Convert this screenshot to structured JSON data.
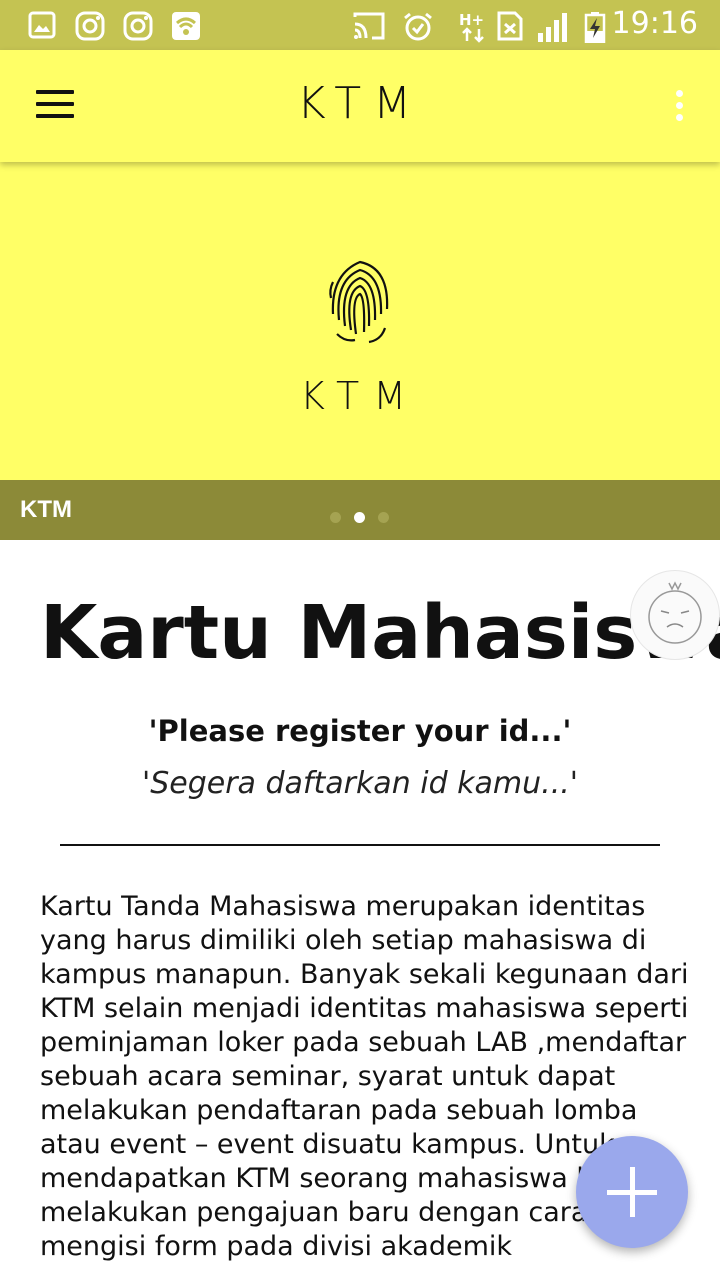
{
  "status_bar": {
    "time": "19:16",
    "icons": [
      "gallery-icon",
      "instagram-icon",
      "instagram-icon",
      "wifi-icon",
      "cast-icon",
      "alarm-icon",
      "network-h-plus-icon",
      "sim-icon",
      "signal-icon",
      "battery-charging-icon"
    ]
  },
  "app_bar": {
    "title": "KTM",
    "menu_icon": "hamburger-menu-icon",
    "overflow_icon": "more-vertical-icon"
  },
  "banner": {
    "logo_text": "KTM",
    "logo_icon": "fingerprint-icon",
    "caption": "KTM",
    "slide_count": 3,
    "active_slide": 2
  },
  "content": {
    "heading": "Kartu Mahasiswa",
    "subtitle_en": "'Please register your id...'",
    "subtitle_id": "'Segera daftarkan id kamu...'",
    "body": "Kartu Tanda Mahasiswa merupakan identitas yang harus dimiliki oleh setiap mahasiswa di kampus manapun. Banyak sekali kegunaan dari KTM selain menjadi identitas mahasiswa seperti peminjaman loker pada sebuah LAB ,mendaftar sebuah acara seminar, syarat untuk dapat melakukan pendaftaran pada sebuah lomba atau event – event disuatu kampus. Untuk mendapatkan KTM seorang mahasiswa harus melakukan pengajuan baru dengan cara mengisi form pada divisi akademik"
  },
  "fab": {
    "icon": "plus-icon"
  },
  "floating_assistant": {
    "icon": "assistant-face-icon"
  },
  "colors": {
    "status_bar": "#c4c352",
    "app_bar": "#ffff66",
    "caption_bar": "#8c8a38",
    "fab": "#9aa8ec"
  }
}
